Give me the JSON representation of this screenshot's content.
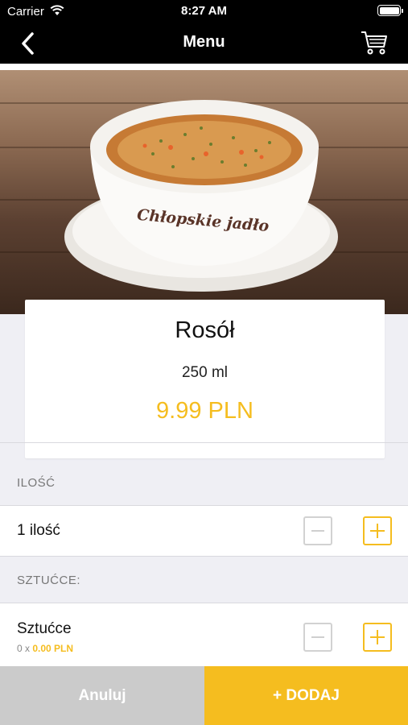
{
  "status_bar": {
    "carrier": "Carrier",
    "time": "8:27 AM"
  },
  "nav": {
    "title": "Menu",
    "back_icon": "chevron-left-icon",
    "cart_icon": "cart-icon"
  },
  "product": {
    "name": "Rosół",
    "volume": "250 ml",
    "price": "9.99 PLN",
    "image_brand_text": "Chłopskie jadło"
  },
  "quantity_section": {
    "header": "ILOŚĆ",
    "label": "1 ilość"
  },
  "cutlery_section": {
    "header": "SZTUĆCE:",
    "label": "Sztućce",
    "count": "0 x",
    "price": "0.00 PLN"
  },
  "footer": {
    "cancel_label": "Anuluj",
    "add_label": "+ DODAJ"
  },
  "colors": {
    "accent": "#f5bd1f",
    "bar": "#000000",
    "background": "#efeff4",
    "disabled": "#cbcbcb"
  }
}
